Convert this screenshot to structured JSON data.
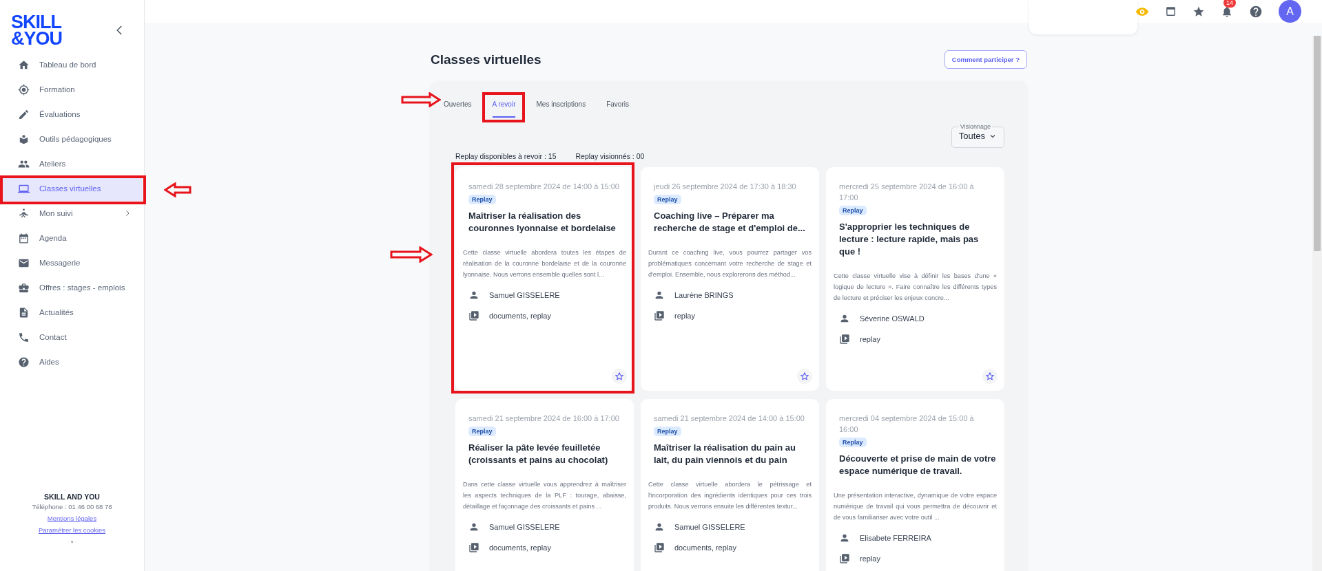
{
  "logo": {
    "lines": [
      "SKILL",
      "&YOU"
    ]
  },
  "sidebar": {
    "items": [
      {
        "label": "Tableau de bord",
        "selected": false,
        "kind": "link"
      },
      {
        "label": "Formation",
        "selected": false,
        "kind": "link"
      },
      {
        "label": "Évaluations",
        "selected": false,
        "kind": "link"
      },
      {
        "label": "Outils pédagogiques",
        "selected": false,
        "kind": "link"
      },
      {
        "label": "Ateliers",
        "selected": false,
        "kind": "link"
      },
      {
        "label": "Classes virtuelles",
        "selected": true,
        "kind": "link"
      },
      {
        "label": "Mon suivi",
        "selected": false,
        "kind": "group"
      },
      {
        "label": "Agenda",
        "selected": false,
        "kind": "link"
      },
      {
        "label": "Messagerie",
        "selected": false,
        "kind": "link"
      },
      {
        "label": "Offres : stages - emplois",
        "selected": false,
        "kind": "link"
      },
      {
        "label": "Actualités",
        "selected": false,
        "kind": "link"
      },
      {
        "label": "Contact",
        "selected": false,
        "kind": "link"
      },
      {
        "label": "Aides",
        "selected": false,
        "kind": "link"
      }
    ],
    "footer": {
      "company": "SKILL AND YOU",
      "phone": "Téléphone : 01 46 00 68 78",
      "links": [
        "Mentions légales",
        "Paramétrer les cookies"
      ],
      "mark": "*"
    }
  },
  "header": {
    "notifications": "14",
    "avatar": "A"
  },
  "page": {
    "title": "Classes virtuelles",
    "help_button": "Comment participer ?"
  },
  "tabs": [
    {
      "label": "Ouvertes",
      "selected": false
    },
    {
      "label": "A revoir",
      "selected": true
    },
    {
      "label": "Mes inscriptions",
      "selected": false
    },
    {
      "label": "Favoris",
      "selected": false
    }
  ],
  "filter": {
    "label": "Visionnage",
    "value": "Toutes"
  },
  "counts": [
    "Replay disponibles à revoir : 15",
    "Replay visionnés : 00"
  ],
  "sessions": [
    {
      "date": "samedi 28 septembre 2024 de 14:00 à 15:00",
      "badge": "Replay",
      "title": "Maîtriser la réalisation des couronnes lyonnaise et bordelaise",
      "description": "Cette classe virtuelle abordera toutes les étapes de réalisation de la couronne bordelaise et de la couronne lyonnaise. Nous verrons ensemble quelles sont l...",
      "trainer": "Samuel GISSELERE",
      "resources": "documents, replay",
      "favorite": false
    },
    {
      "date": "jeudi 26 septembre 2024 de 17:30 à 18:30",
      "badge": "Replay",
      "title": "Coaching live – Préparer ma recherche de stage et d'emploi de...",
      "description": "Durant ce coaching live, vous pourrez partager vos problématiques concernant votre recherche de stage et d'emploi. Ensemble, nous explorerons des méthod...",
      "trainer": "Laurène BRINGS",
      "resources": "replay",
      "favorite": false
    },
    {
      "date": "mercredi 25 septembre 2024 de 16:00 à 17:00",
      "badge": "Replay",
      "title": "S'approprier les techniques de lecture : lecture rapide, mais pas que !",
      "description": "Cette classe virtuelle vise à définir les bases d'une « logique de lecture ». Faire connaître les différents types de lecture et préciser les enjeux concre...",
      "trainer": "Séverine OSWALD",
      "resources": "replay",
      "favorite": false
    },
    {
      "date": "samedi 21 septembre 2024 de 16:00 à 17:00",
      "badge": "Replay",
      "title": "Réaliser la pâte levée feuilletée (croissants et pains au chocolat)",
      "description": "Dans cette classe virtuelle vous apprendrez à maîtriser les aspects techniques de la PLF : tourage, abaisse, détaillage et façonnage des croissants et pains ...",
      "trainer": "Samuel GISSELERE",
      "resources": "documents, replay"
    },
    {
      "date": "samedi 21 septembre 2024 de 14:00 à 15:00",
      "badge": "Replay",
      "title": "Maîtriser la réalisation du pain au lait, du pain viennois et du pain",
      "description": "Cette classe virtuelle abordera le pétrissage et l'incorporation des ingrédients identiques pour ces trois produits. Nous verrons ensuite les différentes textur...",
      "trainer": "Samuel GISSELERE",
      "resources": "documents, replay"
    },
    {
      "date": "mercredi 04 septembre 2024 de 15:00 à 16:00",
      "badge": "Replay",
      "title": "Découverte et prise de main de votre espace numérique de travail.",
      "description": "Une présentation interactive, dynamique de votre espace numérique de travail qui vous permettra de découvrir et de vous familiariser avec votre outil ...",
      "trainer": "Elisabete FERREIRA",
      "resources": "replay"
    }
  ]
}
